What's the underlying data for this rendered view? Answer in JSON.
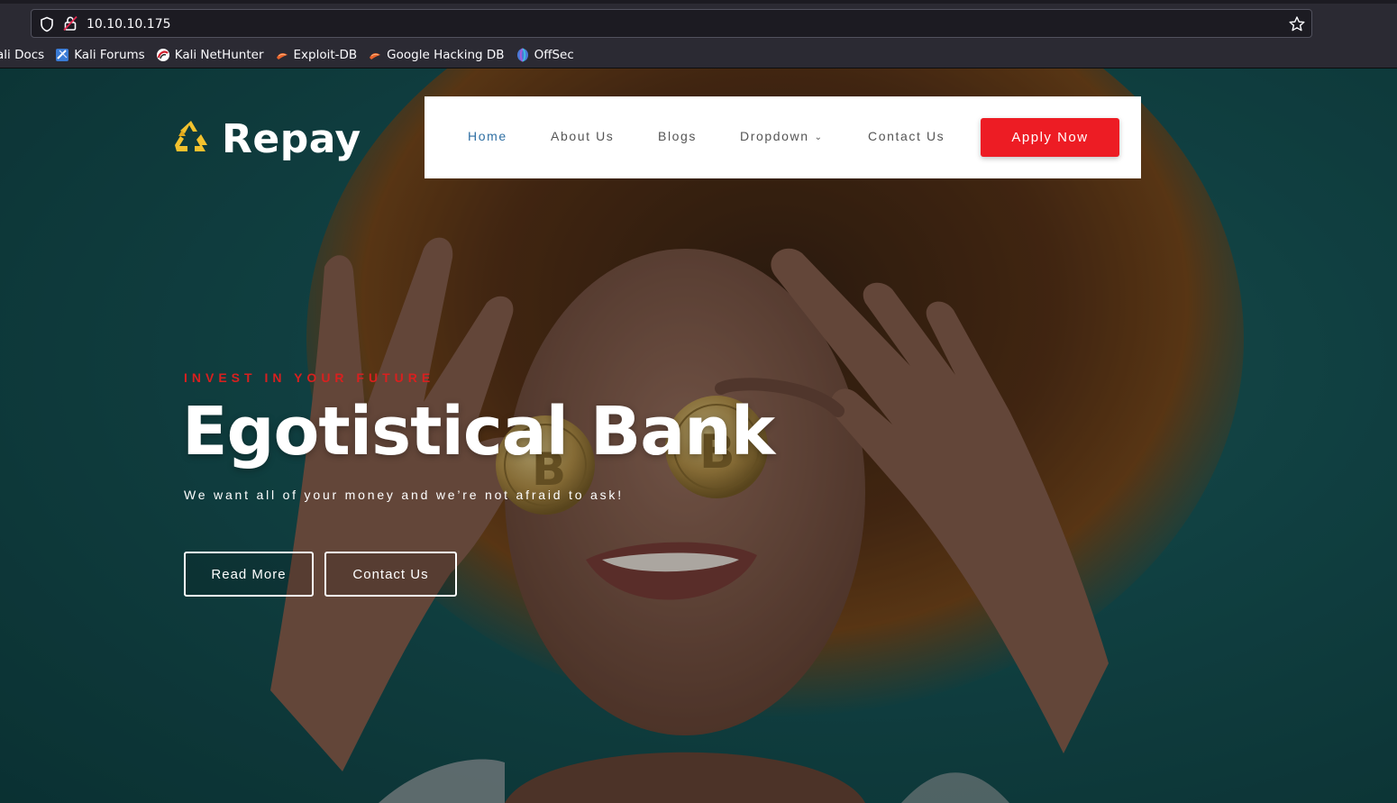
{
  "browser": {
    "url": "10.10.10.175",
    "bookmarks": [
      {
        "label": "ali Docs",
        "icon": "kali-docs-icon"
      },
      {
        "label": "Kali Forums",
        "icon": "kali-forums-icon"
      },
      {
        "label": "Kali NetHunter",
        "icon": "kali-nethunter-icon"
      },
      {
        "label": "Exploit-DB",
        "icon": "exploit-db-icon"
      },
      {
        "label": "Google Hacking DB",
        "icon": "ghdb-icon"
      },
      {
        "label": "OffSec",
        "icon": "offsec-icon"
      }
    ]
  },
  "site": {
    "logo_text": "Repay",
    "nav": {
      "items": [
        "Home",
        "About Us",
        "Blogs",
        "Dropdown",
        "Contact Us"
      ],
      "active": "Home",
      "cta": "Apply Now"
    },
    "hero": {
      "eyebrow": "INVEST IN YOUR FUTURE",
      "title": "Egotistical Bank",
      "subtitle": "We want all of your money and we’re not afraid to ask!",
      "buttons": [
        "Read More",
        "Contact Us"
      ]
    }
  },
  "colors": {
    "accent_red": "#ed1c24",
    "nav_active": "#2f6fa3",
    "hero_bg": "#17585a",
    "logo_yellow": "#f2c12e"
  }
}
